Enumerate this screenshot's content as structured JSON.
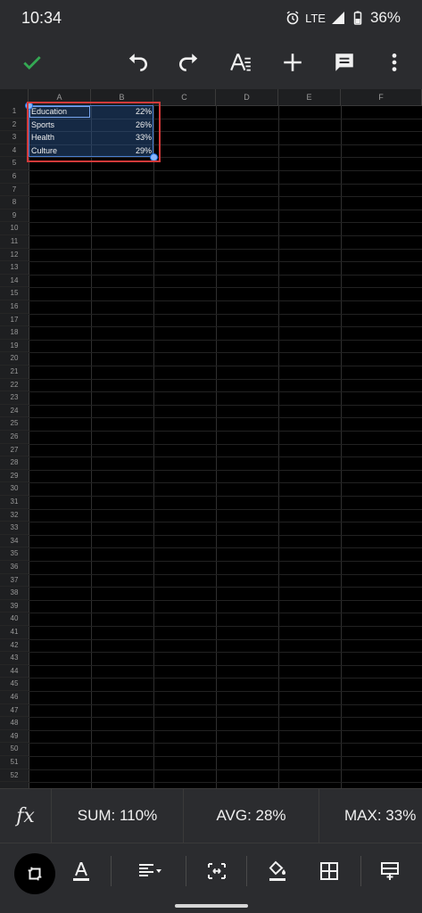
{
  "status_bar": {
    "time": "10:34",
    "network": "LTE",
    "battery": "36%",
    "icons": [
      "alarm-icon",
      "signal-icon",
      "battery-icon"
    ]
  },
  "toolbar": {
    "icons": [
      "check-icon",
      "undo-icon",
      "redo-icon",
      "text-format-icon",
      "add-icon",
      "comment-icon",
      "more-vert-icon"
    ]
  },
  "sheet": {
    "columns": [
      "A",
      "B",
      "C",
      "D",
      "E",
      "F"
    ],
    "rows": [
      "1",
      "2",
      "3",
      "4",
      "5",
      "6",
      "7",
      "8",
      "9",
      "10",
      "11",
      "12",
      "13",
      "14",
      "15",
      "16",
      "17",
      "18",
      "19",
      "20",
      "21",
      "22",
      "23",
      "24",
      "25",
      "26",
      "27",
      "28",
      "29",
      "30",
      "31",
      "32",
      "33",
      "34",
      "35",
      "36",
      "37",
      "38",
      "39",
      "40",
      "41",
      "42",
      "43",
      "44",
      "45",
      "46",
      "47",
      "48",
      "49",
      "50",
      "51",
      "52"
    ],
    "cells": [
      {
        "a": "Education",
        "b": "22%"
      },
      {
        "a": "Sports",
        "b": "26%"
      },
      {
        "a": "Health",
        "b": "33%"
      },
      {
        "a": "Culture",
        "b": "29%"
      }
    ]
  },
  "stats": {
    "fx_label": "fx",
    "sum": "SUM: 110%",
    "avg": "AVG: 28%",
    "max": "MAX: 33%"
  },
  "format_bar": {
    "icons": [
      "select-range-icon",
      "text-color-icon",
      "align-icon",
      "merge-cells-icon",
      "fill-color-icon",
      "borders-icon",
      "insert-row-icon"
    ]
  },
  "colors": {
    "accent": "#34a853",
    "selection": "#4a7fd0",
    "highlight": "#d23a3a"
  }
}
